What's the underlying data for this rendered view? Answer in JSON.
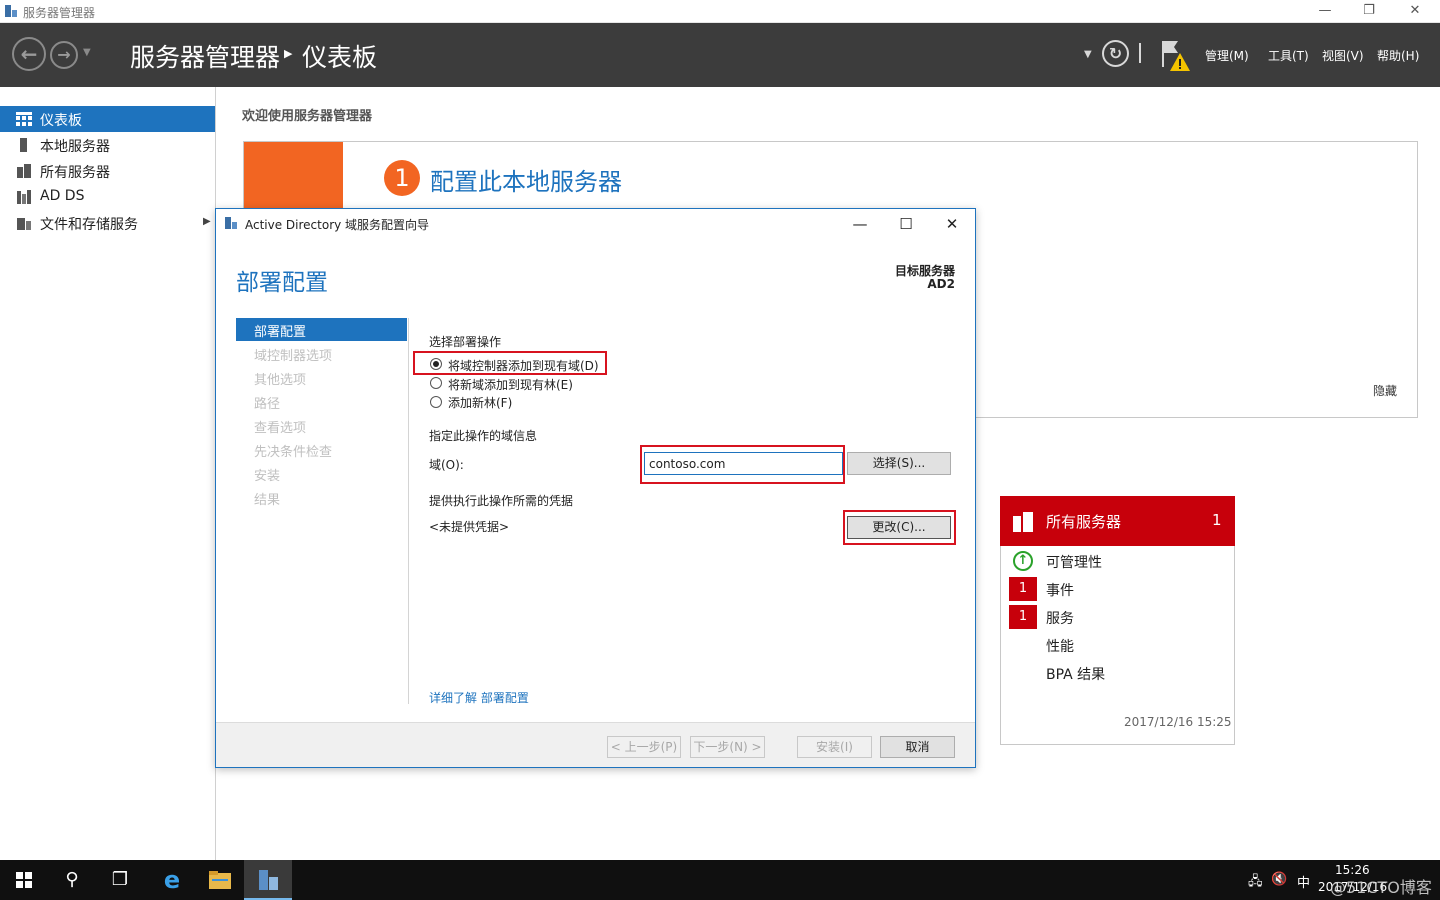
{
  "window": {
    "title": "服务器管理器",
    "minimize": "—",
    "maximize": "❐",
    "close": "✕"
  },
  "header": {
    "app_name": "服务器管理器",
    "page_name": "仪表板",
    "menus": [
      "管理(M)",
      "工具(T)",
      "视图(V)",
      "帮助(H)"
    ]
  },
  "sidebar": {
    "items": [
      {
        "label": "仪表板",
        "icon": "dashboard-icon",
        "active": true
      },
      {
        "label": "本地服务器",
        "icon": "local-server-icon"
      },
      {
        "label": "所有服务器",
        "icon": "all-servers-icon"
      },
      {
        "label": "AD DS",
        "icon": "ad-ds-icon"
      },
      {
        "label": "文件和存储服务",
        "icon": "file-storage-icon",
        "expandable": true
      }
    ]
  },
  "main": {
    "welcome": "欢迎使用服务器管理器",
    "quickstart_number": "1",
    "quickstart_title": "配置此本地服务器",
    "hide": "隐藏"
  },
  "tile": {
    "title": "所有服务器",
    "count": "1",
    "rows": [
      {
        "label": "可管理性",
        "status": "ok"
      },
      {
        "label": "事件",
        "badge": "1"
      },
      {
        "label": "服务",
        "badge": "1"
      },
      {
        "label": "性能"
      },
      {
        "label": "BPA 结果"
      }
    ],
    "timestamp": "2017/12/16 15:25",
    "accent": "#c7000b"
  },
  "wizard": {
    "title": "Active Directory 域服务配置向导",
    "heading": "部署配置",
    "target_label": "目标服务器",
    "target_value": "AD2",
    "steps": [
      "部署配置",
      "域控制器选项",
      "其他选项",
      "路径",
      "查看选项",
      "先决条件检查",
      "安装",
      "结果"
    ],
    "section_operation": "选择部署操作",
    "options": [
      "将域控制器添加到现有域(D)",
      "将新域添加到现有林(E)",
      "添加新林(F)"
    ],
    "section_domain": "指定此操作的域信息",
    "domain_label": "域(O):",
    "domain_value": "contoso.com",
    "select_button": "选择(S)...",
    "section_credentials": "提供执行此操作所需的凭据",
    "credentials_value": "<未提供凭据>",
    "change_button": "更改(C)...",
    "learn_more": "详细了解 部署配置",
    "buttons": {
      "back": "< 上一步(P)",
      "next": "下一步(N) >",
      "install": "安装(I)",
      "cancel": "取消"
    }
  },
  "taskbar": {
    "time": "15:26",
    "date": "2017/12/16",
    "ime": "中",
    "watermark": "@51CTO博客"
  }
}
